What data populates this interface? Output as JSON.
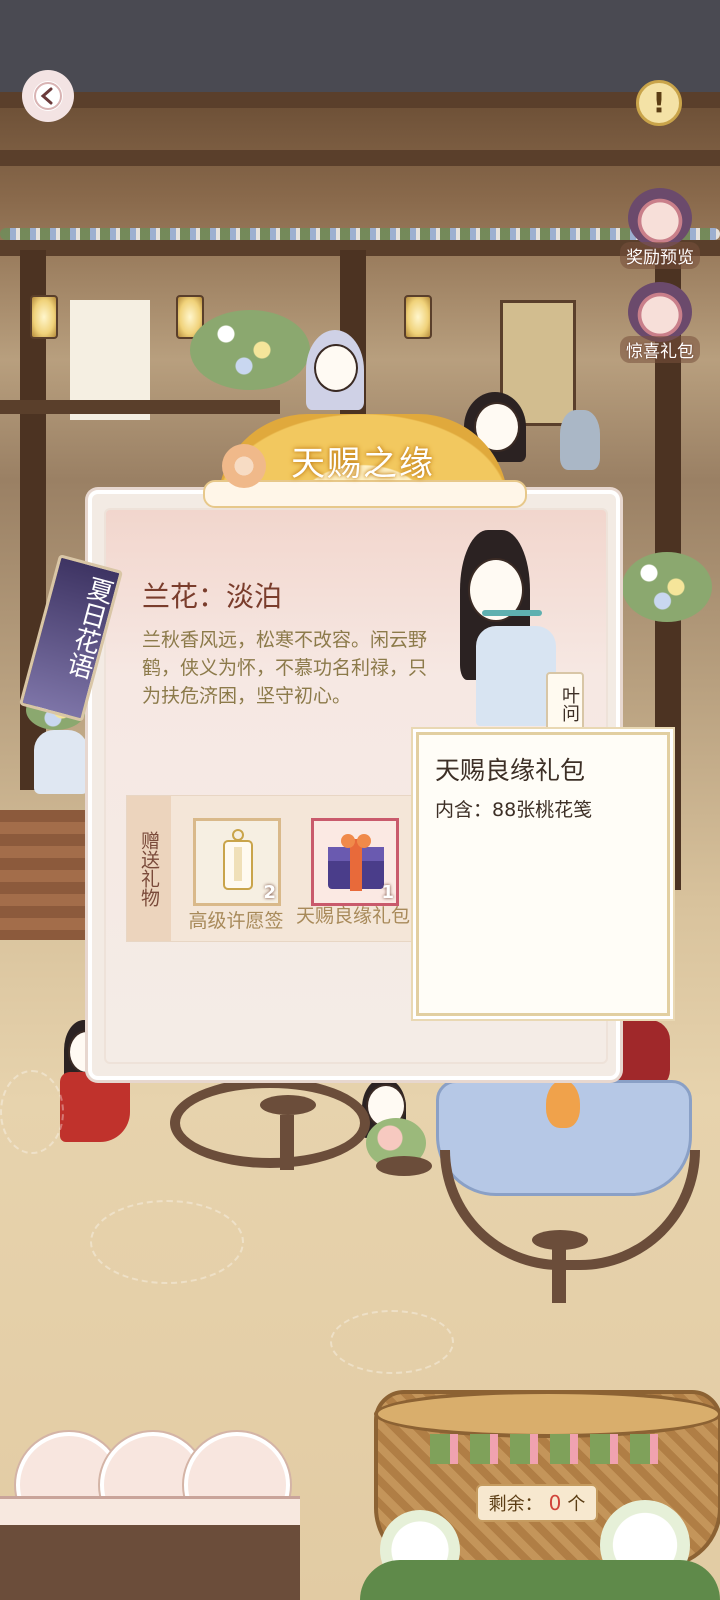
{
  "event": {
    "banner_title": "天赐之缘",
    "tag_text": "夏日花语"
  },
  "side_buttons": {
    "reward_preview": "奖励预览",
    "surprise_gift": "惊喜礼包"
  },
  "flower": {
    "title": "兰花：淡泊",
    "description": "兰秋香风远，松寒不改容。闲云野鹤，侠义为怀，不慕功名利禄，只为扶危济困，坚守初心。"
  },
  "character_name": "叶问",
  "gifts": {
    "section_label": "赠送礼物",
    "items": [
      {
        "name": "高级许愿签",
        "count": "2",
        "icon": "wish-tag-icon"
      },
      {
        "name": "天赐良缘礼包",
        "count": "1",
        "icon": "gift-box-icon"
      }
    ]
  },
  "tooltip": {
    "title": "天赐良缘礼包",
    "content": "内含：88张桃花笺"
  },
  "basket": {
    "remaining_label": "剩余：",
    "remaining_value": "0",
    "remaining_unit": "个"
  },
  "colors": {
    "accent_gold": "#f2c85f",
    "count_red": "#d0443a",
    "title_brown": "#7a3d2c"
  }
}
